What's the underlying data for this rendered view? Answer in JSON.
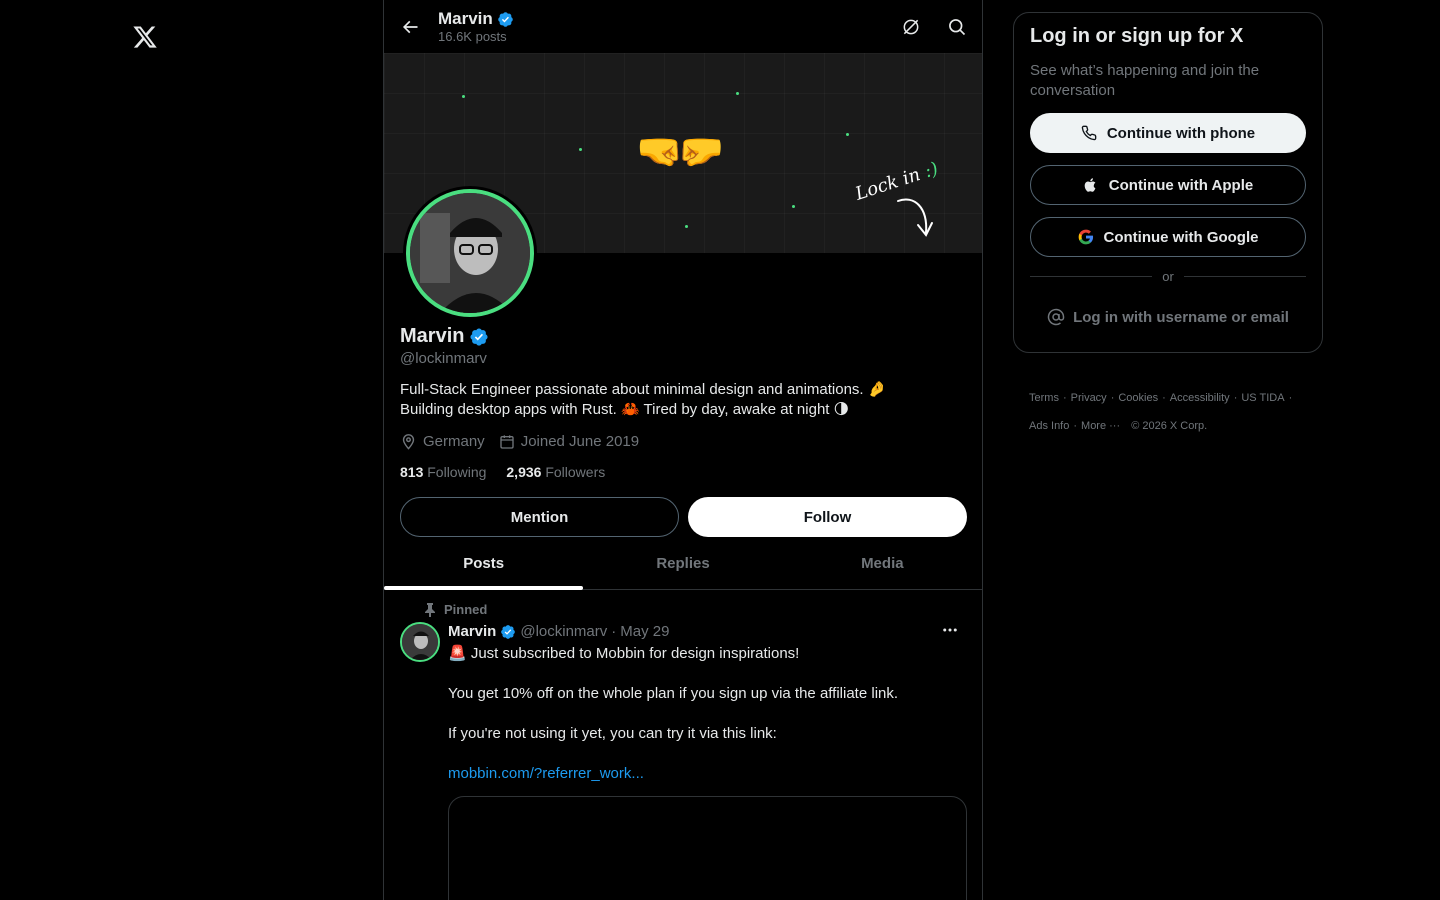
{
  "colors": {
    "accent_blue": "#1d9bf0",
    "verified_blue": "#1d9bf0",
    "ring_green": "#4ade80",
    "text_primary": "#e7e9ea",
    "text_secondary": "#71767b",
    "border": "#2f3336",
    "background": "#000000"
  },
  "nav": {
    "logo_icon": "x-logo-icon"
  },
  "header": {
    "title": "Marvin",
    "post_count": "16.6K posts",
    "back_icon": "arrow-left-icon",
    "right_icons": [
      "grok-icon",
      "search-icon"
    ]
  },
  "banner": {
    "emoji": "🤜🤛",
    "handwriting": "Lock in",
    "handwriting_smile": ":)"
  },
  "profile": {
    "name": "Marvin",
    "handle": "@lockinmarv",
    "bio_line1": "Full-Stack Engineer passionate about minimal design and animations. 🤌",
    "bio_line2": "Building desktop apps with Rust. 🦀 Tired by day, awake at night 🌗",
    "location": "Germany",
    "joined": "Joined June 2019",
    "following_count": "813",
    "following_label": "Following",
    "followers_count": "2,936",
    "followers_label": "Followers"
  },
  "actions": {
    "mention": "Mention",
    "follow": "Follow"
  },
  "tabs": [
    {
      "label": "Posts",
      "active": true
    },
    {
      "label": "Replies",
      "active": false
    },
    {
      "label": "Media",
      "active": false
    }
  ],
  "post": {
    "pinned_label": "Pinned",
    "author": "Marvin",
    "handle": "@lockinmarv",
    "separator": "·",
    "date": "May 29",
    "line1": "🚨 Just subscribed to Mobbin for design inspirations!",
    "line2": "You get 10% off on the whole plan if you sign up via the affiliate link.",
    "line3": "If you're not using it yet, you can try it via this link:",
    "link": "mobbin.com/?referrer_work..."
  },
  "login": {
    "title": "Log in or sign up for X",
    "subtitle": "See what’s happening and join the conversation",
    "phone": "Continue with phone",
    "apple": "Continue with Apple",
    "google": "Continue with Google",
    "or": "or",
    "username": "Log in with username or email"
  },
  "footer": {
    "terms": "Terms",
    "privacy": "Privacy",
    "cookies": "Cookies",
    "accessibility": "Accessibility",
    "us_tida": "US TIDA",
    "ads_info": "Ads Info",
    "more": "More ···",
    "copyright": "© 2026 X Corp.",
    "dot": "·"
  }
}
